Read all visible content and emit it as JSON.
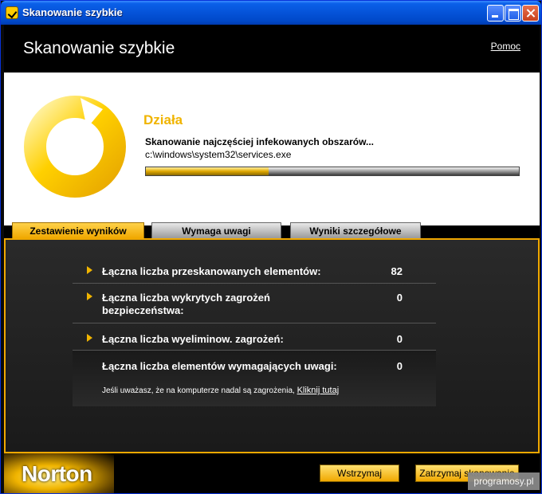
{
  "window": {
    "title": "Skanowanie szybkie"
  },
  "header": {
    "title": "Skanowanie szybkie",
    "help_link": "Pomoc"
  },
  "status": {
    "state": "Działa",
    "description": "Skanowanie najczęściej infekowanych obszarów...",
    "current_file": "c:\\windows\\system32\\services.exe",
    "progress_fraction": 0.33
  },
  "tabs": [
    {
      "label": "Zestawienie wyników",
      "active": true
    },
    {
      "label": "Wymaga uwagi",
      "active": false
    },
    {
      "label": "Wyniki szczegółowe",
      "active": false
    }
  ],
  "results": [
    {
      "label": "Łączna liczba przeskanowanych elementów:",
      "value": "82"
    },
    {
      "label": "Łączna liczba wykrytych zagrożeń bezpieczeństwa:",
      "value": "0"
    },
    {
      "label": "Łączna liczba wyeliminow. zagrożeń:",
      "value": "0"
    },
    {
      "label": "Łączna liczba elementów wymagających uwagi:",
      "value": "0"
    }
  ],
  "note": {
    "text": "Jeśli uważasz, że na komputerze nadal są zagrożenia,",
    "link": "Kliknij tutaj"
  },
  "footer": {
    "brand": "Norton",
    "pause_button": "Wstrzymaj",
    "stop_button": "Zatrzymaj skanowanie"
  },
  "watermark": "programosy.pl",
  "colors": {
    "accent": "#f0b400",
    "titlebar": "#0553d8",
    "background": "#1a1a1a"
  },
  "icons": {
    "title_icon": "norton-check-icon",
    "status_icon": "progress-ring-icon"
  }
}
